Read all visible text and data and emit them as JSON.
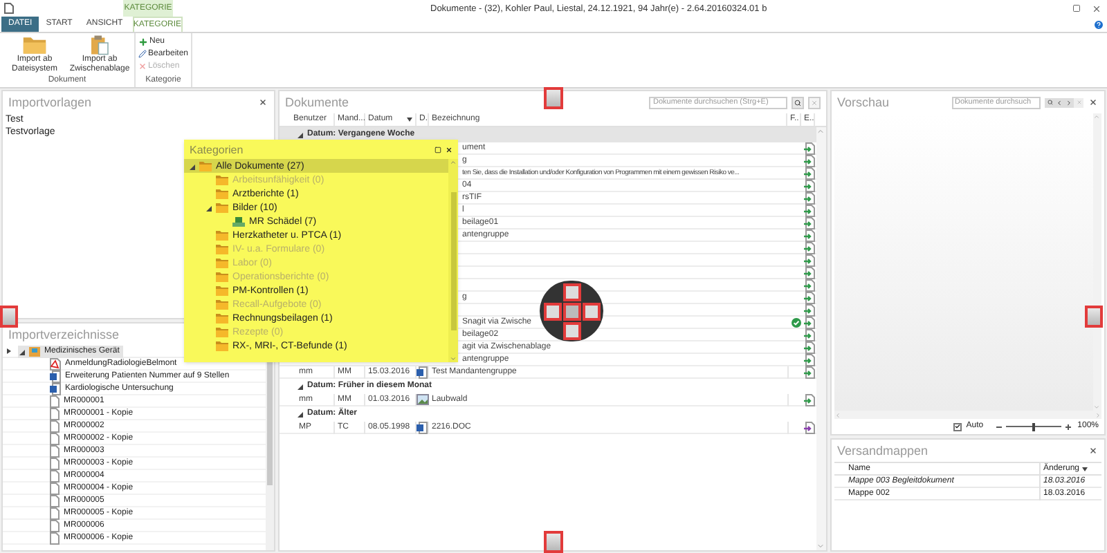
{
  "window": {
    "title": "Dokumente - (32), Kohler Paul, Liestal, 24.12.1921, 94 Jahr(e) - 2.64.20160324.01 b",
    "context_group": "KATEGORIE"
  },
  "tabs": [
    {
      "label": "DATEI",
      "kind": "file",
      "selected": false
    },
    {
      "label": "START",
      "kind": "tab",
      "selected": false
    },
    {
      "label": "ANSICHT",
      "kind": "tab",
      "selected": false
    },
    {
      "label": "KATEGORIE",
      "kind": "context",
      "selected": true
    }
  ],
  "ribbon": [
    {
      "label": "Dokument",
      "kind": "large",
      "buttons": [
        {
          "label": "Import ab Dateisystem",
          "kind": "folder",
          "disabled": false
        },
        {
          "label": "Import ab Zwischenablage",
          "kind": "clipboard",
          "disabled": false
        }
      ]
    },
    {
      "label": "Kategorie",
      "kind": "small",
      "buttons": [
        {
          "label": "Neu",
          "kind": "plus",
          "disabled": false
        },
        {
          "label": "Bearbeiten",
          "kind": "pencil",
          "disabled": false
        },
        {
          "label": "Löschen",
          "kind": "delete",
          "disabled": true
        }
      ]
    }
  ],
  "import_templates": {
    "title": "Importvorlagen",
    "items": [
      "Test",
      "Testvorlage"
    ]
  },
  "import_dirs": {
    "title": "Importverzeichnisse",
    "tree": [
      {
        "label": "Medizinisches Gerät",
        "expanded": true,
        "current": true,
        "children": [
          {
            "label": "AnmeldungRadiologieBelmont",
            "kind": "pdf"
          },
          {
            "label": "Erweiterung Patienten Nummer auf 9 Stellen",
            "kind": "word"
          },
          {
            "label": "Kardiologische Untersuchung",
            "kind": "word"
          },
          {
            "label": "MR000001",
            "kind": "file"
          },
          {
            "label": "MR000001 - Kopie",
            "kind": "file"
          },
          {
            "label": "MR000002",
            "kind": "file"
          },
          {
            "label": "MR000002 - Kopie",
            "kind": "file"
          },
          {
            "label": "MR000003",
            "kind": "file"
          },
          {
            "label": "MR000003 - Kopie",
            "kind": "file"
          },
          {
            "label": "MR000004",
            "kind": "file"
          },
          {
            "label": "MR000004 - Kopie",
            "kind": "file"
          },
          {
            "label": "MR000005",
            "kind": "file"
          },
          {
            "label": "MR000005 - Kopie",
            "kind": "file"
          },
          {
            "label": "MR000006",
            "kind": "file"
          },
          {
            "label": "MR000006 - Kopie",
            "kind": "file"
          }
        ]
      }
    ]
  },
  "documents": {
    "title": "Dokumente",
    "search": {
      "placeholder": "Dokumente durchsuchen (Strg+E)"
    },
    "columns": [
      "Benutzer",
      "Mand...",
      "Datum",
      "D.",
      "Bezeichnung",
      "F..",
      "E.."
    ],
    "groups": [
      {
        "label": "Datum: Vergangene Woche",
        "expanded": true,
        "rows": [
          {
            "kind": "partial",
            "name": "ument",
            "export": false,
            "verified": false
          },
          {
            "kind": "partial",
            "name": "g",
            "export": false,
            "verified": false
          },
          {
            "kind": "partial",
            "name": "ten Sie, dass die Installation und/oder Konfiguration von Programmen mit einem gewissen Risiko ve...",
            "export": false,
            "verified": false
          },
          {
            "kind": "partial",
            "name": "04",
            "export": false,
            "verified": false
          },
          {
            "kind": "partial",
            "name": "rsTIF",
            "export": false,
            "verified": false
          },
          {
            "kind": "partial",
            "name": "l",
            "export": false,
            "verified": false
          },
          {
            "kind": "partial",
            "name": "beilage01",
            "export": false,
            "verified": false
          },
          {
            "kind": "partial",
            "name": "antengruppe",
            "export": false,
            "verified": false
          },
          {
            "kind": "partial",
            "export": false,
            "verified": false
          },
          {
            "kind": "partial",
            "export": false,
            "verified": false
          },
          {
            "kind": "partial",
            "export": false,
            "verified": false
          },
          {
            "kind": "partial",
            "export": false,
            "verified": false
          },
          {
            "kind": "partial",
            "name": "g",
            "export": false,
            "verified": false
          },
          {
            "kind": "partial",
            "export": false,
            "verified": false
          },
          {
            "kind": "partial",
            "name": "Snagit via Zwische",
            "export": false,
            "verified": true
          },
          {
            "kind": "partial",
            "name": "beilage02",
            "export": false,
            "verified": false
          },
          {
            "kind": "partial",
            "name": "agit via Zwischenablage",
            "export": false,
            "verified": false
          },
          {
            "kind": "partial",
            "name": "antengruppe",
            "export": false,
            "verified": false
          },
          {
            "kind": "word",
            "user": "mm",
            "client": "MM",
            "date": "15.03.2016",
            "name": "Test Mandantengruppe",
            "export": false,
            "verified": false
          }
        ]
      },
      {
        "label": "Datum: Früher in diesem Monat",
        "expanded": true,
        "rows": [
          {
            "kind": "image",
            "user": "mm",
            "client": "MM",
            "date": "01.03.2016",
            "name": "Laubwald",
            "export": false,
            "verified": false
          }
        ]
      },
      {
        "label": "Datum: Älter",
        "expanded": true,
        "rows": [
          {
            "kind": "word",
            "user": "MP",
            "client": "TC",
            "date": "08.05.1998",
            "name": "2216.DOC",
            "export": true,
            "verified": false
          }
        ]
      }
    ]
  },
  "categories": {
    "title": "Kategorien",
    "items": [
      {
        "label": "Alle Dokumente (27)",
        "kind": "folder",
        "selected": true,
        "empty": false,
        "expanded": true,
        "children": [
          {
            "label": "Arbeitsunfähigkeit (0)",
            "kind": "folder",
            "selected": false,
            "empty": true
          },
          {
            "label": "Arztberichte (1)",
            "kind": "folder",
            "selected": false,
            "empty": false
          },
          {
            "label": "Bilder (10)",
            "kind": "folder",
            "selected": false,
            "empty": false,
            "expanded": true,
            "children": [
              {
                "label": "MR Schädel (7)",
                "kind": "device",
                "selected": false,
                "empty": false
              }
            ]
          },
          {
            "label": "Herzkatheter u. PTCA (1)",
            "kind": "folder",
            "selected": false,
            "empty": false
          },
          {
            "label": "IV- u.a. Formulare (0)",
            "kind": "folder",
            "selected": false,
            "empty": true
          },
          {
            "label": "Labor (0)",
            "kind": "folder",
            "selected": false,
            "empty": true
          },
          {
            "label": "Operationsberichte (0)",
            "kind": "folder",
            "selected": false,
            "empty": true
          },
          {
            "label": "PM-Kontrollen (1)",
            "kind": "folder",
            "selected": false,
            "empty": false
          },
          {
            "label": "Recall-Aufgebote (0)",
            "kind": "folder",
            "selected": false,
            "empty": true
          },
          {
            "label": "Rechnungsbeilagen (1)",
            "kind": "folder",
            "selected": false,
            "empty": false
          },
          {
            "label": "Rezepte (0)",
            "kind": "folder",
            "selected": false,
            "empty": true
          },
          {
            "label": "RX-, MRI-, CT-Befunde (1)",
            "kind": "folder",
            "selected": false,
            "empty": false
          }
        ]
      }
    ]
  },
  "preview": {
    "title": "Vorschau",
    "search": {
      "placeholder": "Dokumente durchsuch"
    },
    "auto": {
      "label": "Auto",
      "checked": true
    },
    "zoom": {
      "level": 0.5,
      "reading": "100%"
    }
  },
  "mailing_folders": {
    "title": "Versandmappen",
    "columns": [
      "Name",
      "Änderung"
    ],
    "rows": [
      {
        "name": "Mappe 003 Begleitdokument",
        "date": "18.03.2016",
        "emphasized": true
      },
      {
        "name": "Mappe 002",
        "date": "18.03.2016",
        "emphasized": false
      }
    ]
  }
}
